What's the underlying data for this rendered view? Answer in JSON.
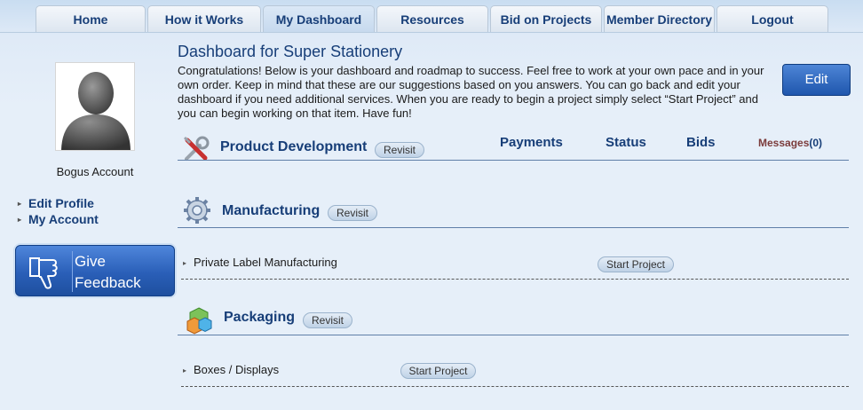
{
  "nav": {
    "tabs": [
      {
        "label": "Home"
      },
      {
        "label": "How it Works"
      },
      {
        "label": "My Dashboard",
        "active": true
      },
      {
        "label": "Resources"
      },
      {
        "label": "Bid on Projects"
      },
      {
        "label": "Member Directory"
      },
      {
        "label": "Logout"
      }
    ]
  },
  "sidebar": {
    "account_name": "Bogus Account",
    "links": [
      {
        "label": "Edit Profile"
      },
      {
        "label": "My Account"
      }
    ],
    "feedback": {
      "line1": "Give",
      "line2": "Feedback"
    }
  },
  "main": {
    "title": "Dashboard for Super Stationery",
    "intro": "Congratulations! Below is your dashboard and roadmap to success. Feel free to work at your own pace and in your own order. Keep in mind that these are our suggestions based on you answers. You can go back and edit your dashboard if you need additional services. When you are ready to begin a project simply select “Start Project” and you can begin working on that item. Have fun!",
    "edit_label": "Edit",
    "columns": {
      "payments": "Payments",
      "status": "Status",
      "bids": "Bids",
      "messages": "Messages",
      "messages_count": "(0)"
    },
    "sections": [
      {
        "title": "Product Development",
        "revisit": "Revisit",
        "icon": "tools-icon",
        "items": []
      },
      {
        "title": "Manufacturing",
        "revisit": "Revisit",
        "icon": "gear-icon",
        "items": [
          {
            "label": "Private Label Manufacturing",
            "action": "Start Project"
          }
        ]
      },
      {
        "title": "Packaging",
        "revisit": "Revisit",
        "icon": "boxes-icon",
        "items": [
          {
            "label": "Boxes / Displays",
            "action": "Start Project"
          }
        ]
      }
    ]
  },
  "colors": {
    "brand_blue": "#173e78",
    "button_blue": "#1f56ad",
    "background": "#e6eff9"
  }
}
